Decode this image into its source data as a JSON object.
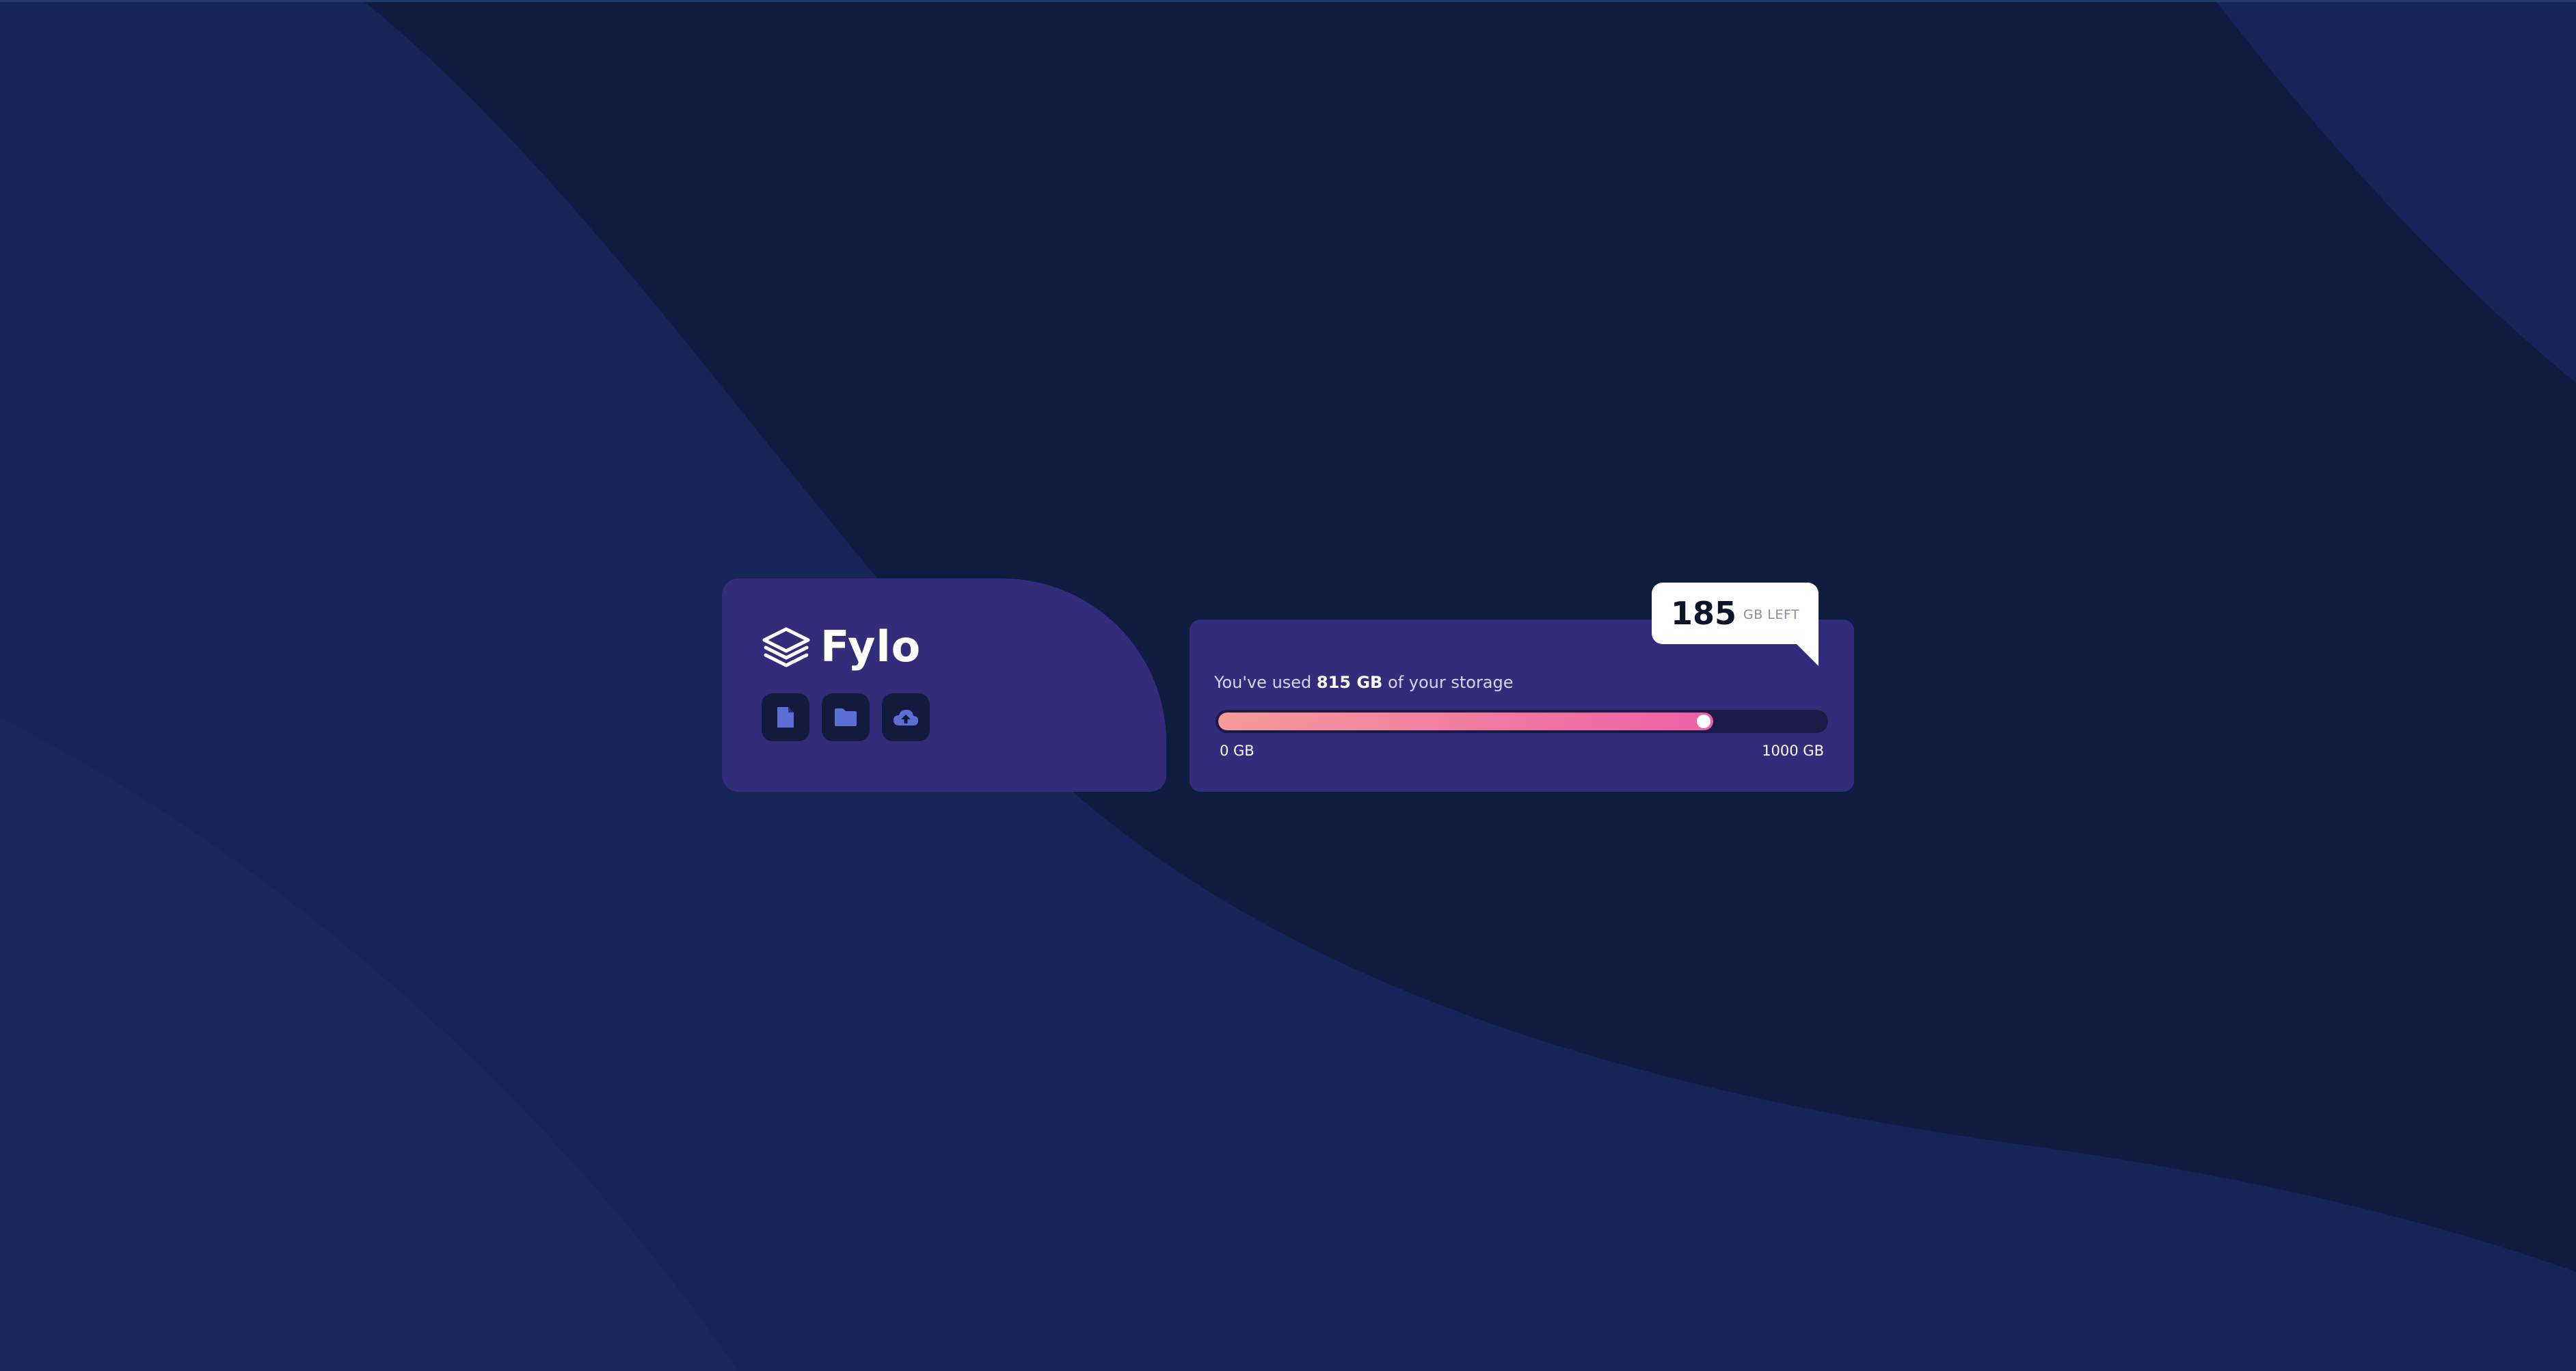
{
  "app": {
    "name": "Fylo"
  },
  "toolbar": {
    "buttons": [
      {
        "icon": "document-icon"
      },
      {
        "icon": "folder-icon"
      },
      {
        "icon": "cloud-upload-icon"
      }
    ]
  },
  "storage": {
    "used_prefix": "You've used ",
    "used_amount": "815 GB",
    "used_suffix": " of your storage",
    "min_label": "0 GB",
    "max_label": "1000 GB",
    "used_fraction": 0.815,
    "left_value": "185",
    "left_unit": "GB LEFT"
  },
  "colors": {
    "background": "#0f1b3f",
    "card": "#332c7b",
    "icon_tile": "#141a3b",
    "icon_fill": "#5c6fd6",
    "gradient_start": "#f59a9a",
    "gradient_end": "#ed5fa6",
    "track": "#1b1a47"
  }
}
